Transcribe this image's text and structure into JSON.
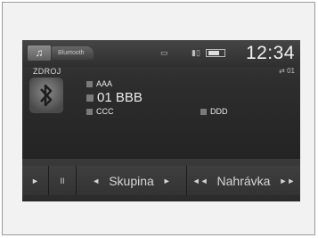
{
  "status": {
    "source_tab": "Bluetooth",
    "clock": "12:34",
    "icons": [
      "music-note-icon",
      "phone-screen-icon",
      "signal-icon",
      "battery-icon"
    ]
  },
  "source": {
    "label": "ZDROJ",
    "logo": "bluetooth-icon",
    "track_number": "01"
  },
  "track": {
    "artist": "AAA",
    "title": "01 BBB",
    "album": "CCC",
    "extra": "DDD"
  },
  "controls": {
    "play_symbol": "►",
    "pause_symbol": "II",
    "group_prev_symbol": "◄",
    "group_label": "Skupina",
    "group_next_symbol": "►",
    "track_prev_symbol": "◄◄",
    "track_label": "Nahrávka",
    "track_next_symbol": "►►"
  }
}
